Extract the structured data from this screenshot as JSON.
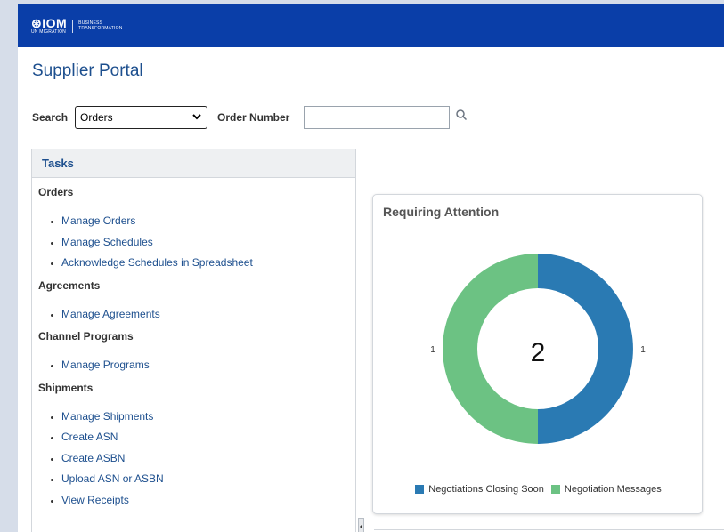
{
  "header": {
    "logo_mark": "⊛IOM",
    "logo_sub": "UN MIGRATION",
    "logo_bt_1": "BUSINESS",
    "logo_bt_2": "TRANSFORMATION"
  },
  "page": {
    "title": "Supplier Portal"
  },
  "search": {
    "label": "Search",
    "selected": "Orders",
    "order_number_label": "Order Number",
    "order_number_value": ""
  },
  "tasks": {
    "title": "Tasks",
    "sections": [
      {
        "title": "Orders",
        "links": [
          "Manage Orders",
          "Manage Schedules",
          "Acknowledge Schedules in Spreadsheet"
        ]
      },
      {
        "title": "Agreements",
        "links": [
          "Manage Agreements"
        ]
      },
      {
        "title": "Channel Programs",
        "links": [
          "Manage Programs"
        ]
      },
      {
        "title": "Shipments",
        "links": [
          "Manage Shipments",
          "Create ASN",
          "Create ASBN",
          "Upload ASN or ASBN",
          "View Receipts"
        ]
      }
    ]
  },
  "attention": {
    "title": "Requiring Attention",
    "total": "2",
    "left_value": "1",
    "right_value": "1",
    "legend": [
      {
        "label": "Negotiations Closing Soon",
        "color": "#2a7ab3"
      },
      {
        "label": "Negotiation Messages",
        "color": "#6cc283"
      }
    ]
  },
  "chart_data": {
    "type": "pie",
    "title": "Requiring Attention",
    "categories": [
      "Negotiations Closing Soon",
      "Negotiation Messages"
    ],
    "values": [
      1,
      1
    ],
    "center_label": "2",
    "legend_position": "bottom"
  },
  "colors": {
    "brand": "#0a3ea8",
    "link": "#1d4f8e",
    "slice_blue": "#2a7ab3",
    "slice_green": "#6cc283"
  }
}
